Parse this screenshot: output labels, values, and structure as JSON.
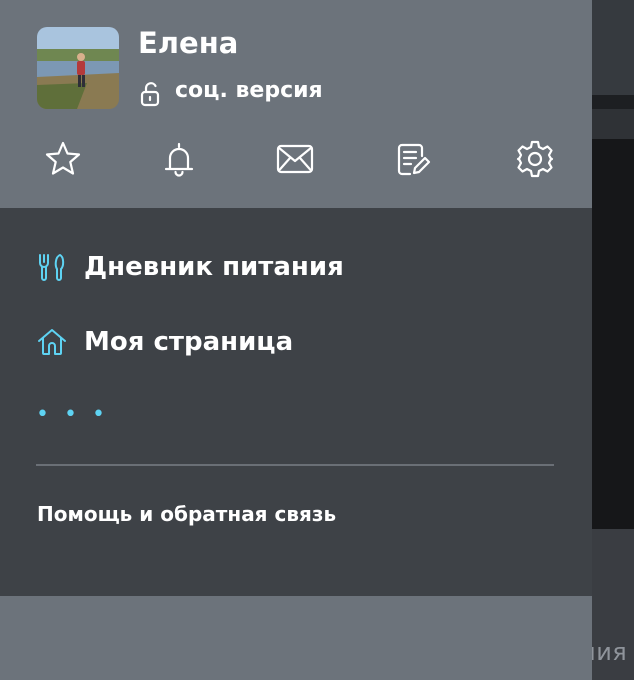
{
  "profile": {
    "name": "Елена",
    "version_label": "соц. версия",
    "avatar_alt": "Фото профиля"
  },
  "toolbar": {
    "items": [
      {
        "icon": "star-icon"
      },
      {
        "icon": "bell-icon"
      },
      {
        "icon": "mail-icon"
      },
      {
        "icon": "notes-edit-icon"
      },
      {
        "icon": "gear-icon"
      }
    ]
  },
  "menu": {
    "items": [
      {
        "label": "Дневник питания",
        "icon": "fork-knife-icon"
      },
      {
        "label": "Моя страница",
        "icon": "home-icon"
      }
    ],
    "more_label": "• • •"
  },
  "footer": {
    "help_label": "Помощь и обратная связь"
  },
  "background": {
    "partial_text": "ния"
  },
  "colors": {
    "accent": "#5ed3f3",
    "header_bg": "#6c737b",
    "body_bg": "#3e4247"
  }
}
